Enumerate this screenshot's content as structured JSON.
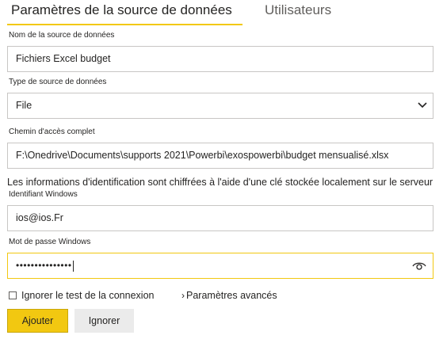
{
  "tabs": [
    {
      "label": "Paramètres de la source de données",
      "active": true
    },
    {
      "label": "Utilisateurs",
      "active": false
    }
  ],
  "form": {
    "name": {
      "label": "Nom de la source de données",
      "value": "Fichiers Excel budget"
    },
    "type": {
      "label": "Type de source de données",
      "value": "File"
    },
    "path": {
      "label": "Chemin d'accès complet",
      "value": "F:\\Onedrive\\Documents\\supports 2021\\Powerbi\\exospowerbi\\budget mensualisé.xlsx"
    },
    "info_text": "Les informations d'identification sont chiffrées à l'aide d'une clé stockée localement sur le serveur",
    "windows_user": {
      "label": "Identifiant Windows",
      "value": "ios@ios.Fr"
    },
    "windows_password": {
      "label": "Mot de passe Windows",
      "masked_value": "•••••••••••••••"
    },
    "skip_test": {
      "label": "Ignorer le test de la connexion",
      "checked": false
    },
    "advanced_label": "Paramètres avancés"
  },
  "buttons": {
    "add": "Ajouter",
    "ignore": "Ignorer"
  },
  "icons": {
    "select": "chevron-down-icon",
    "password": "eye-icon",
    "advanced": "chevron-right-icon"
  },
  "colors": {
    "accent": "#f2c811",
    "border": "#c8c6c4",
    "secondary_button": "#ebebeb"
  }
}
